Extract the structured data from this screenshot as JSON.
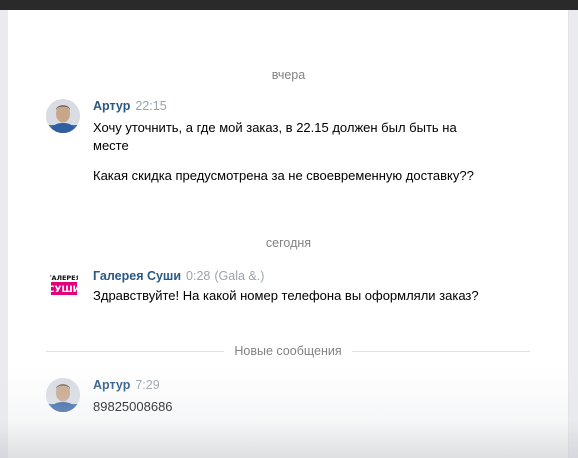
{
  "dates": {
    "yesterday": "вчера",
    "today": "сегодня"
  },
  "messages": [
    {
      "author": "Артур",
      "time": "22:15",
      "avatar_icon": "user-photo-icon",
      "paragraphs": [
        "Хочу уточнить, а где мой заказ, в 22.15 должен был быть на месте",
        "Какая скидка предусмотрена за не своевременную доставку??"
      ]
    },
    {
      "author": "Галерея Суши",
      "time": "0:28",
      "sub": "(Gala &.)",
      "avatar_icon": "galereya-sushi-logo-icon",
      "logo_text_1": "ГАЛЕРЕЯ",
      "logo_text_2": "СУШИ",
      "paragraphs": [
        "Здравствуйте! На какой номер телефона вы оформляли заказ?"
      ]
    },
    {
      "author": "Артур",
      "time": "7:29",
      "avatar_icon": "user-photo-icon",
      "paragraphs": [
        "89825008686"
      ]
    }
  ],
  "new_messages_label": "Новые сообщения",
  "colors": {
    "author": "#2a5885",
    "muted": "#828282",
    "logo_pink": "#e4007c"
  }
}
